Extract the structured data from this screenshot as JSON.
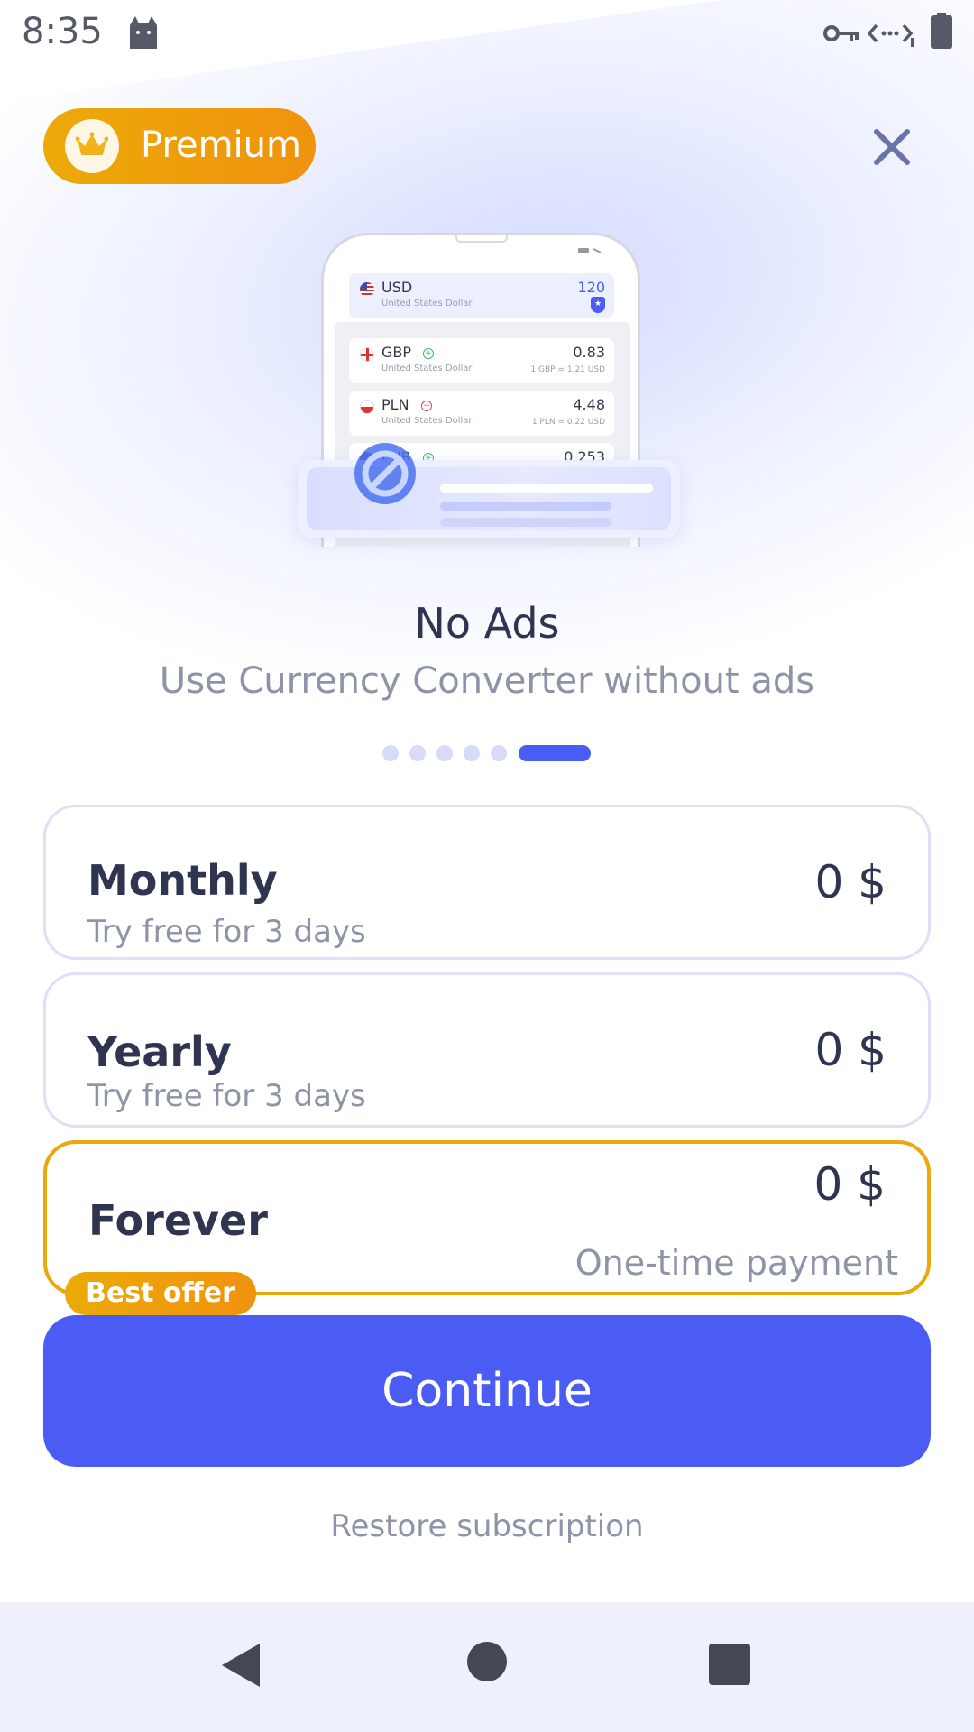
{
  "status_bar": {
    "time": "8:35",
    "icons": [
      "cat-icon",
      "vpn-key-icon",
      "data-transfer-icon",
      "battery-icon"
    ]
  },
  "header": {
    "badge_label": "Premium",
    "badge_icon": "crown-icon",
    "close_icon": "close-icon"
  },
  "illustration": {
    "currencies": [
      {
        "code": "USD",
        "name": "United States Dollar",
        "value": "120",
        "rate": ""
      },
      {
        "code": "GBP",
        "name": "United States Dollar",
        "value": "0.83",
        "rate": "1 GBP = 1.21 USD",
        "trend": "up"
      },
      {
        "code": "PLN",
        "name": "United States Dollar",
        "value": "4.48",
        "rate": "1 PLN = 0.22 USD",
        "trend": "down"
      },
      {
        "code": "EUR",
        "name": "",
        "value": "0.253",
        "rate": "",
        "trend": "up"
      }
    ]
  },
  "feature": {
    "title": "No Ads",
    "subtitle": "Use Currency Converter without ads",
    "page_count": 6,
    "active_page": 6
  },
  "plans": [
    {
      "name": "Monthly",
      "subtitle": "Try free for 3 days",
      "price": "0 $",
      "selected": false
    },
    {
      "name": "Yearly",
      "subtitle": "Try free for 3 days",
      "price": "0 $",
      "selected": false
    },
    {
      "name": "Forever",
      "note": "One-time payment",
      "price": "0 $",
      "badge": "Best offer",
      "selected": true
    }
  ],
  "actions": {
    "continue_label": "Continue",
    "restore_label": "Restore subscription"
  },
  "colors": {
    "accent": "#4b5cf5",
    "premium": "#ecaa08",
    "text_primary": "#2f3450",
    "text_secondary": "#8e94a8"
  }
}
